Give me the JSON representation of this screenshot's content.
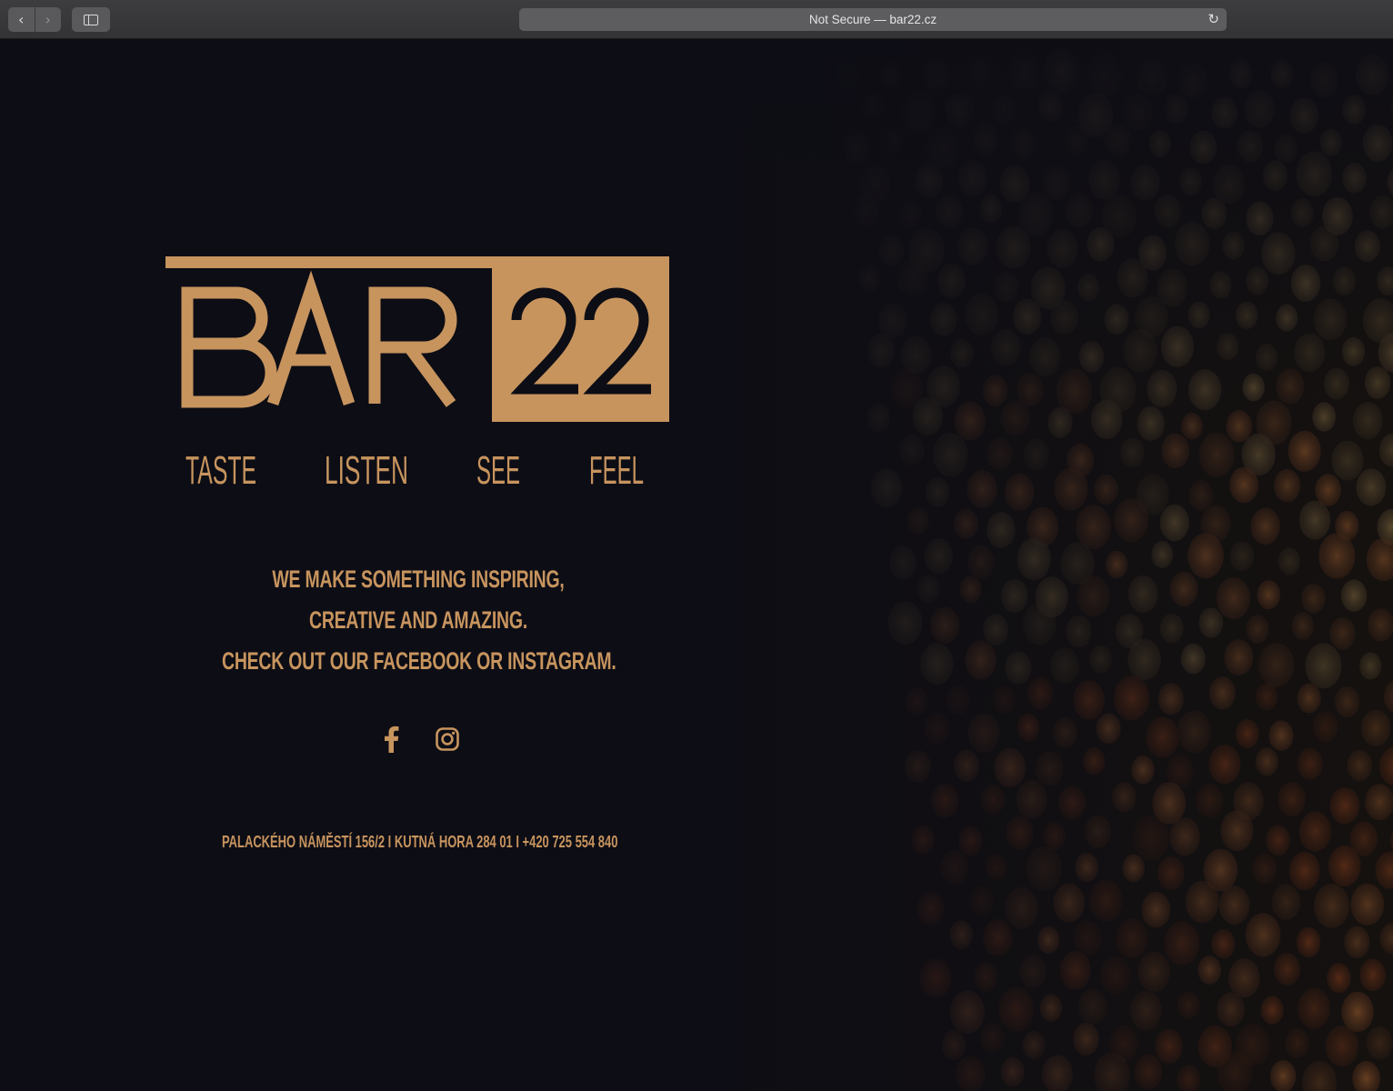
{
  "browser": {
    "back_icon": "chevron-left-icon",
    "forward_icon": "chevron-right-icon",
    "sidebar_icon": "sidebar-icon",
    "reload_icon": "reload-icon",
    "address": "Not Secure — bar22.cz"
  },
  "brand": {
    "logo_text": "BAR22",
    "taglines": [
      "TASTE",
      "LISTEN",
      "SEE",
      "FEEL"
    ],
    "color": "#c7945e"
  },
  "slogan": {
    "lines": [
      "WE MAKE SOMETHING INSPIRING,",
      "CREATIVE AND AMAZING.",
      "CHECK OUT OUR FACEBOOK OR INSTAGRAM."
    ]
  },
  "socials": {
    "facebook_icon": "facebook-icon",
    "instagram_icon": "instagram-icon"
  },
  "contact": {
    "line": "PALACKÉHO NÁMĚSTÍ 156/2  I  KUTNÁ HORA 284 01  I  +420 725 554 840"
  }
}
